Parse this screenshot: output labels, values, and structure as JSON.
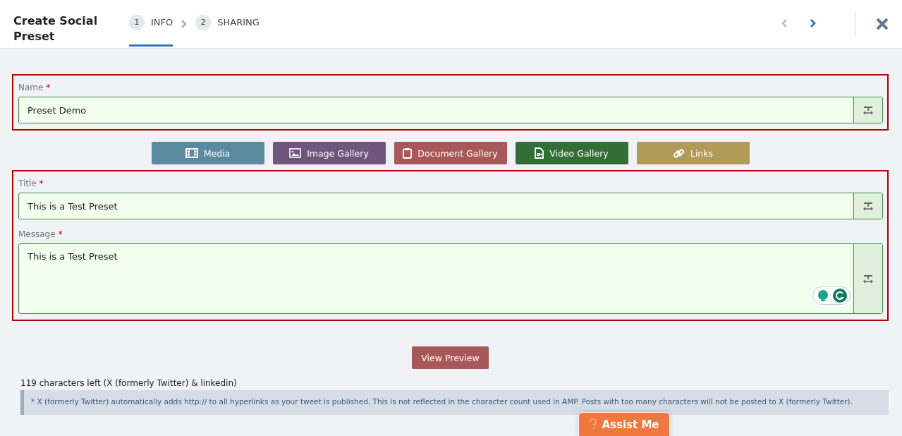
{
  "header": {
    "title": "Create Social Preset",
    "steps": [
      {
        "number": "1",
        "label": "INFO",
        "selected": true
      },
      {
        "number": "2",
        "label": "SHARING",
        "selected": false
      }
    ],
    "nav": [
      {
        "kind": "prev",
        "disabled": true
      },
      {
        "kind": "next",
        "disabled": false
      }
    ]
  },
  "name_section": {
    "fields": [
      {
        "label": "Name",
        "required_mark": "*",
        "value": "Preset Demo",
        "kind": "input"
      }
    ]
  },
  "media_buttons": [
    {
      "label": "Media",
      "kind": "film",
      "color": "#5a8a9e"
    },
    {
      "label": "Image Gallery",
      "kind": "image",
      "color": "#6e567e"
    },
    {
      "label": "Document Gallery",
      "kind": "clipboard",
      "color": "#a85858"
    },
    {
      "label": "Video Gallery",
      "kind": "video",
      "color": "#336e36"
    },
    {
      "label": "Links",
      "kind": "link",
      "color": "#b29a58"
    }
  ],
  "content_section": {
    "fields": [
      {
        "label": "Title",
        "required_mark": "*",
        "value": "This is a Test Preset",
        "kind": "input"
      },
      {
        "label": "Message",
        "required_mark": "*",
        "value": "This is a Test Preset",
        "kind": "textarea"
      }
    ]
  },
  "preview_button": "View Preview",
  "char_count": "119 characters left (X (formerly Twitter) & linkedin)",
  "note": "* X (formerly Twitter) automatically adds http:// to all hyperlinks as your tweet is published. This is not reflected in the character count used in AMP. Posts with too many characters will not be posted to X (formerly Twitter).",
  "assist_button": "Assist Me"
}
